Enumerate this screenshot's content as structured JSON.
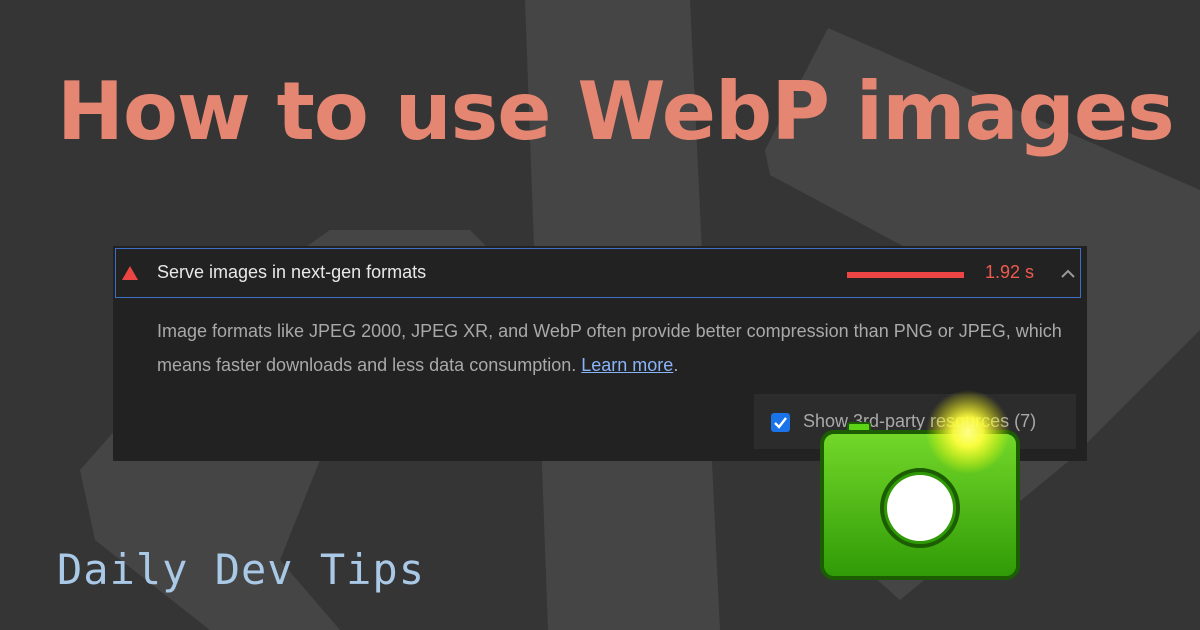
{
  "page": {
    "title": "How to use WebP images",
    "brand": "Daily Dev Tips"
  },
  "audit": {
    "title": "Serve images in next-gen formats",
    "savings": "1.92 s",
    "savings_fraction": 1.0,
    "description": "Image formats like JPEG 2000, JPEG XR, and WebP often provide better compression than PNG or JPEG, which means faster downloads and less data consumption.",
    "learn_more": "Learn more",
    "description_end": ".",
    "third_party_label": "Show 3rd-party resources (7)",
    "third_party_checked": true,
    "status_icon": "warning-triangle-icon",
    "toggle_icon": "chevron-up-icon"
  },
  "colors": {
    "background": "#353535",
    "title": "#e48672",
    "brand": "#a9c9e6",
    "fail": "#ed4444",
    "link": "#8ab4f8",
    "accent_border": "#3d70c4"
  },
  "decor": {
    "camera_icon": "camera-icon"
  }
}
